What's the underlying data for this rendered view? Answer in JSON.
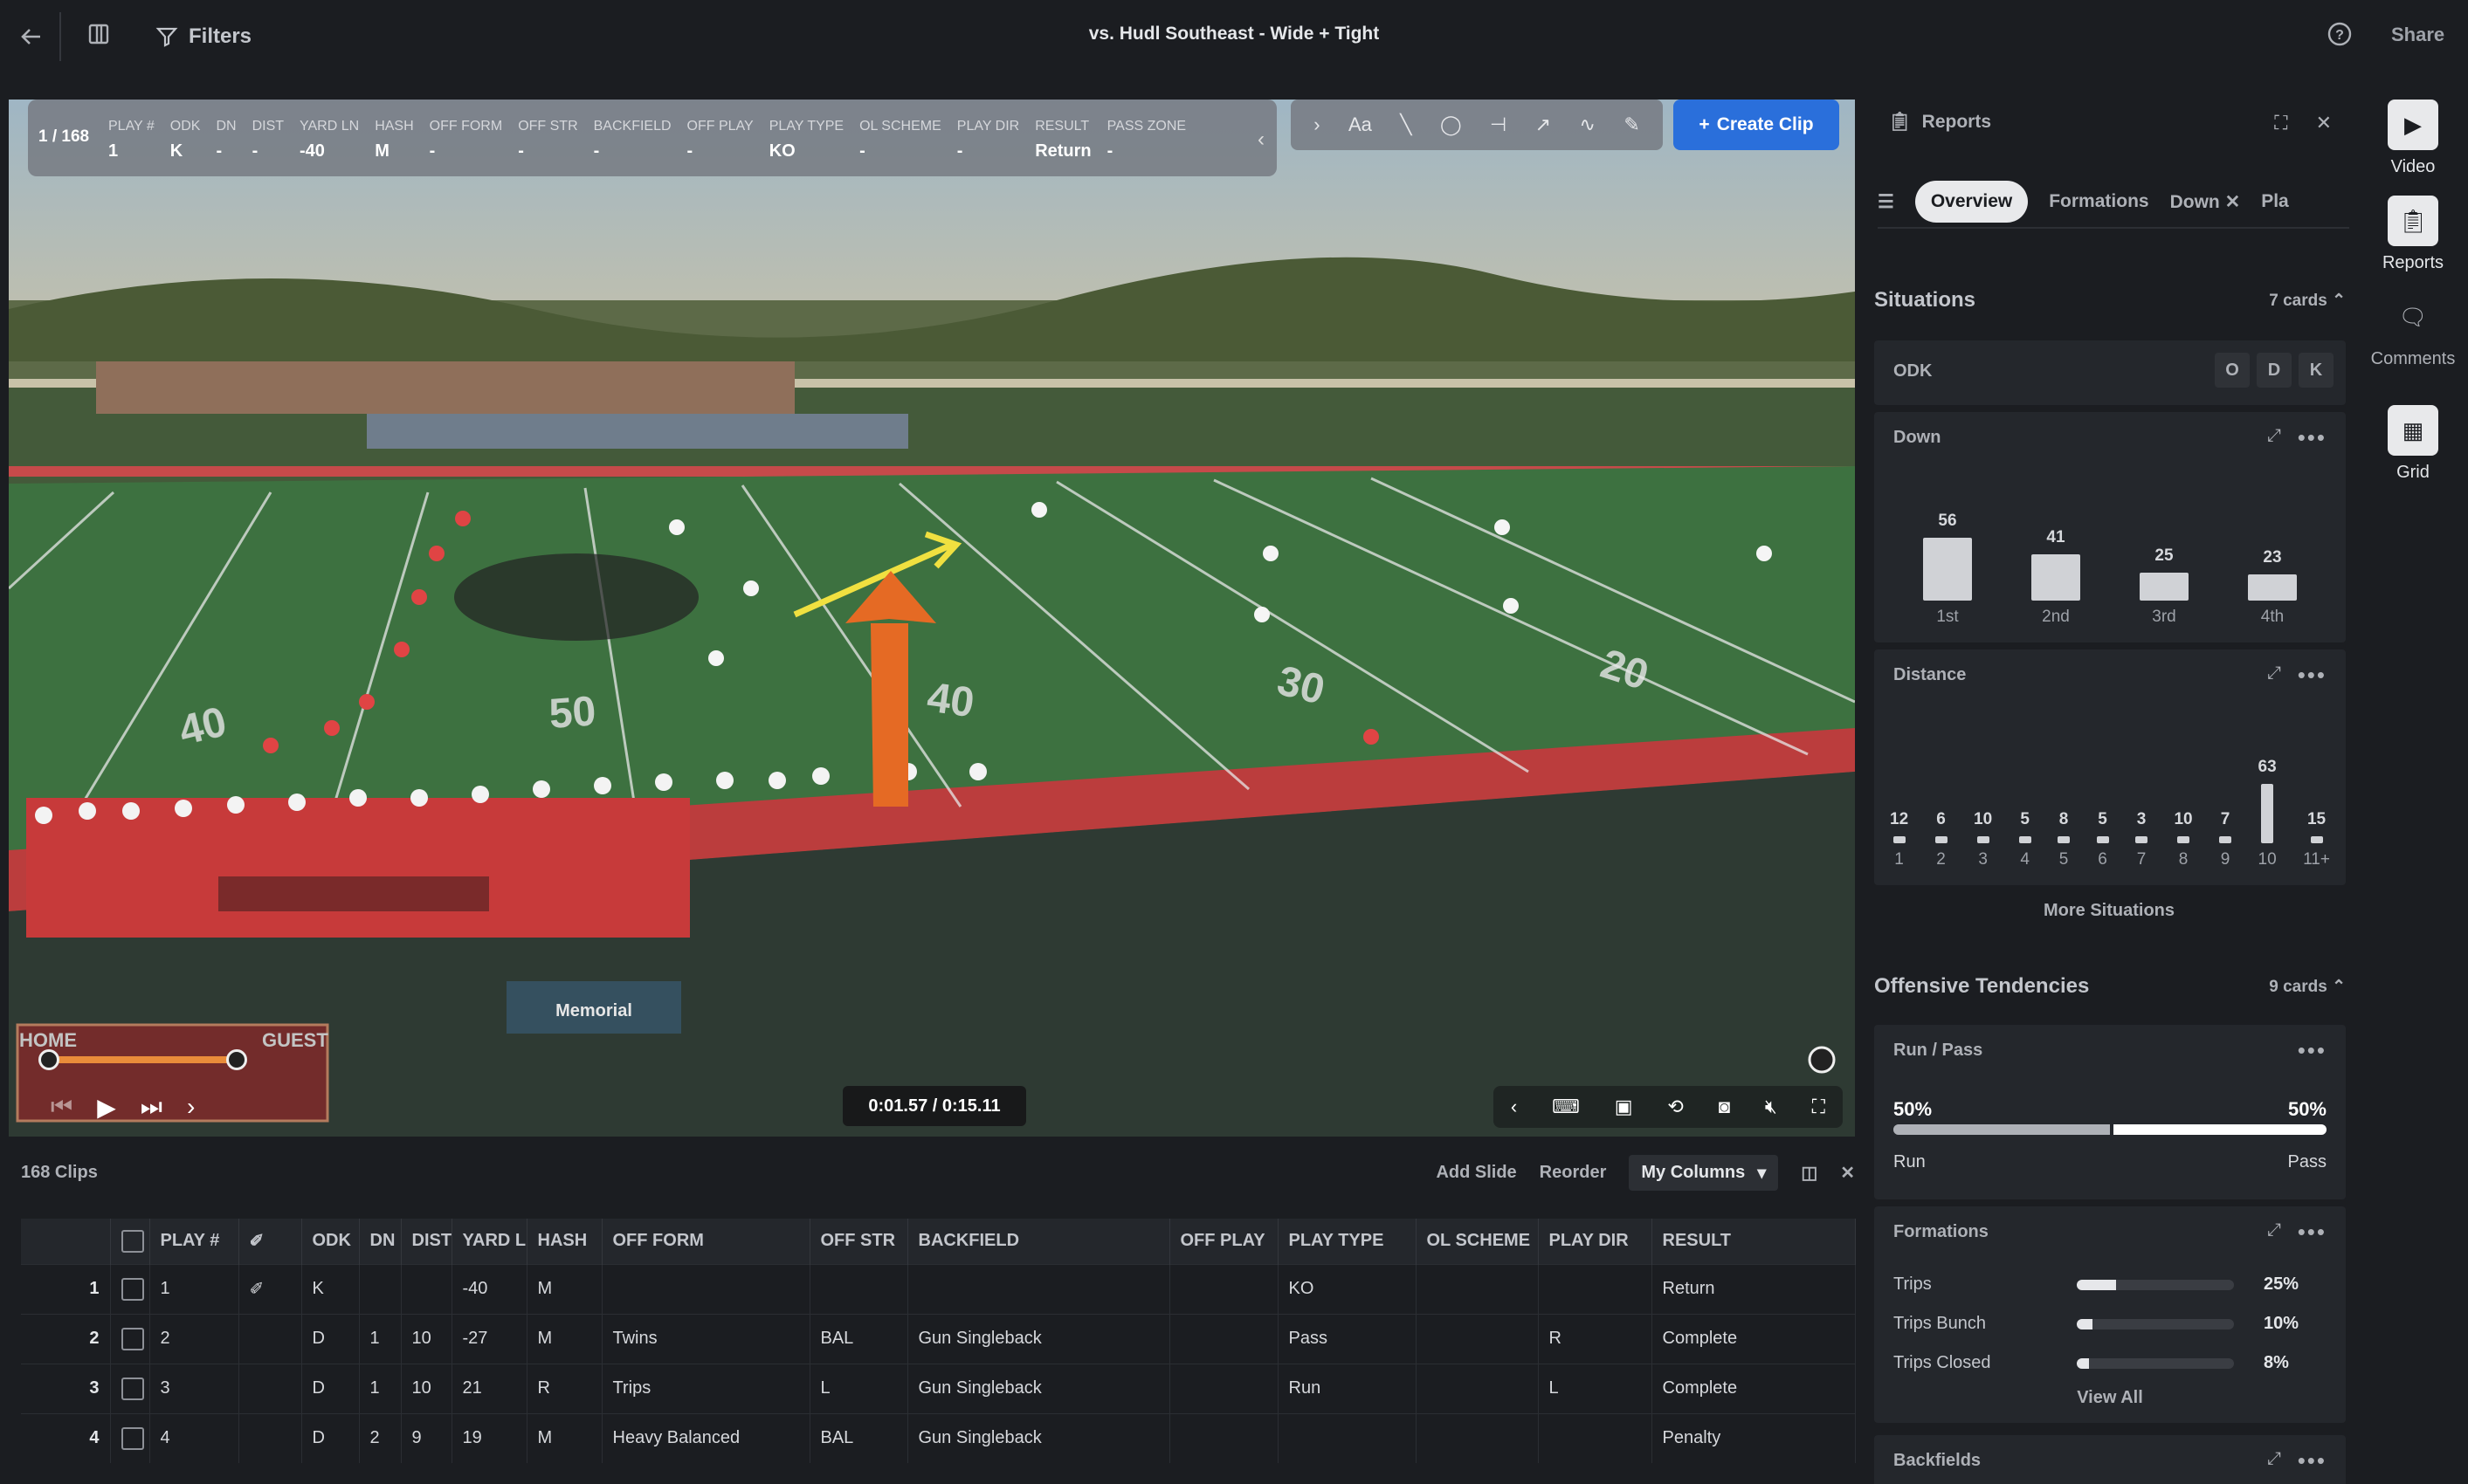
{
  "topbar": {
    "filters_label": "Filters",
    "title": "vs. Hudl Southeast - Wide + Tight",
    "share_label": "Share"
  },
  "video": {
    "counter": "1 / 168",
    "fields": [
      {
        "h": "PLAY #",
        "v": "1"
      },
      {
        "h": "ODK",
        "v": "K"
      },
      {
        "h": "DN",
        "v": "-"
      },
      {
        "h": "DIST",
        "v": "-"
      },
      {
        "h": "YARD LN",
        "v": "-40"
      },
      {
        "h": "HASH",
        "v": "M"
      },
      {
        "h": "OFF FORM",
        "v": "-"
      },
      {
        "h": "OFF STR",
        "v": "-"
      },
      {
        "h": "BACKFIELD",
        "v": "-"
      },
      {
        "h": "OFF PLAY",
        "v": "-"
      },
      {
        "h": "PLAY TYPE",
        "v": "KO"
      },
      {
        "h": "OL SCHEME",
        "v": "-"
      },
      {
        "h": "PLAY DIR",
        "v": "-"
      },
      {
        "h": "RESULT",
        "v": "Return"
      },
      {
        "h": "PASS ZONE",
        "v": "-"
      }
    ],
    "draw_text_tool": "Aa",
    "create_clip_label": "Create Clip",
    "timecode": "0:01.57 / 0:15.11",
    "progress": 0.96,
    "scoreboard_home": "HOME",
    "scoreboard_guest": "GUEST",
    "sign_text": "Memorial",
    "field_numbers": [
      "50",
      "40",
      "30",
      "20",
      "40"
    ]
  },
  "table": {
    "clips_label": "168 Clips",
    "add_slide": "Add Slide",
    "reorder": "Reorder",
    "my_columns": "My Columns",
    "columns": [
      "PLAY #",
      "ODK",
      "DN",
      "DIST",
      "YARD LN",
      "HASH",
      "OFF FORM",
      "OFF STR",
      "BACKFIELD",
      "OFF PLAY",
      "PLAY TYPE",
      "OL SCHEME",
      "PLAY DIR",
      "RESULT"
    ],
    "rows": [
      {
        "n": "1",
        "play": "1",
        "odk": "K",
        "dn": "",
        "dist": "",
        "yard": "-40",
        "hash": "M",
        "form": "",
        "str": "",
        "back": "",
        "offplay": "",
        "type": "KO",
        "ol": "",
        "dir": "",
        "result": "Return"
      },
      {
        "n": "2",
        "play": "2",
        "odk": "D",
        "dn": "1",
        "dist": "10",
        "yard": "-27",
        "hash": "M",
        "form": "Twins",
        "str": "BAL",
        "back": "Gun Singleback",
        "offplay": "",
        "type": "Pass",
        "ol": "",
        "dir": "R",
        "result": "Complete"
      },
      {
        "n": "3",
        "play": "3",
        "odk": "D",
        "dn": "1",
        "dist": "10",
        "yard": "21",
        "hash": "R",
        "form": "Trips",
        "str": "L",
        "back": "Gun Singleback",
        "offplay": "",
        "type": "Run",
        "ol": "",
        "dir": "L",
        "result": "Complete"
      },
      {
        "n": "4",
        "play": "4",
        "odk": "D",
        "dn": "2",
        "dist": "9",
        "yard": "19",
        "hash": "M",
        "form": "Heavy Balanced",
        "str": "BAL",
        "back": "Gun Singleback",
        "offplay": "",
        "type": "",
        "ol": "",
        "dir": "",
        "result": "Penalty"
      }
    ]
  },
  "reports": {
    "title": "Reports",
    "tabs": [
      "Overview",
      "Formations",
      "Down",
      "Pla"
    ],
    "situations": {
      "title": "Situations",
      "count": "7 cards"
    },
    "odk": {
      "label": "ODK",
      "buttons": [
        "O",
        "D",
        "K"
      ]
    },
    "down": {
      "label": "Down",
      "chart_data": {
        "type": "bar",
        "categories": [
          "1st",
          "2nd",
          "3rd",
          "4th"
        ],
        "values": [
          56,
          41,
          25,
          23
        ]
      }
    },
    "distance": {
      "label": "Distance",
      "chart_data": {
        "type": "bar",
        "categories": [
          "1",
          "2",
          "3",
          "4",
          "5",
          "6",
          "7",
          "8",
          "9",
          "10",
          "11+"
        ],
        "values": [
          12,
          6,
          10,
          5,
          8,
          5,
          3,
          10,
          7,
          63,
          15
        ]
      }
    },
    "more_situations": "More Situations",
    "offensive": {
      "title": "Offensive Tendencies",
      "count": "9 cards"
    },
    "run_pass": {
      "label": "Run / Pass",
      "left_pct": "50%",
      "right_pct": "50%",
      "left": "Run",
      "right": "Pass",
      "run_fraction": 0.5
    },
    "formations": {
      "label": "Formations",
      "rows": [
        {
          "name": "Trips",
          "pct": "25%",
          "frac": 0.25
        },
        {
          "name": "Trips Bunch",
          "pct": "10%",
          "frac": 0.1
        },
        {
          "name": "Trips Closed",
          "pct": "8%",
          "frac": 0.08
        }
      ],
      "view_all": "View All"
    },
    "backfields": {
      "label": "Backfields"
    }
  },
  "rail": {
    "video": "Video",
    "reports": "Reports",
    "comments": "Comments",
    "grid": "Grid"
  }
}
